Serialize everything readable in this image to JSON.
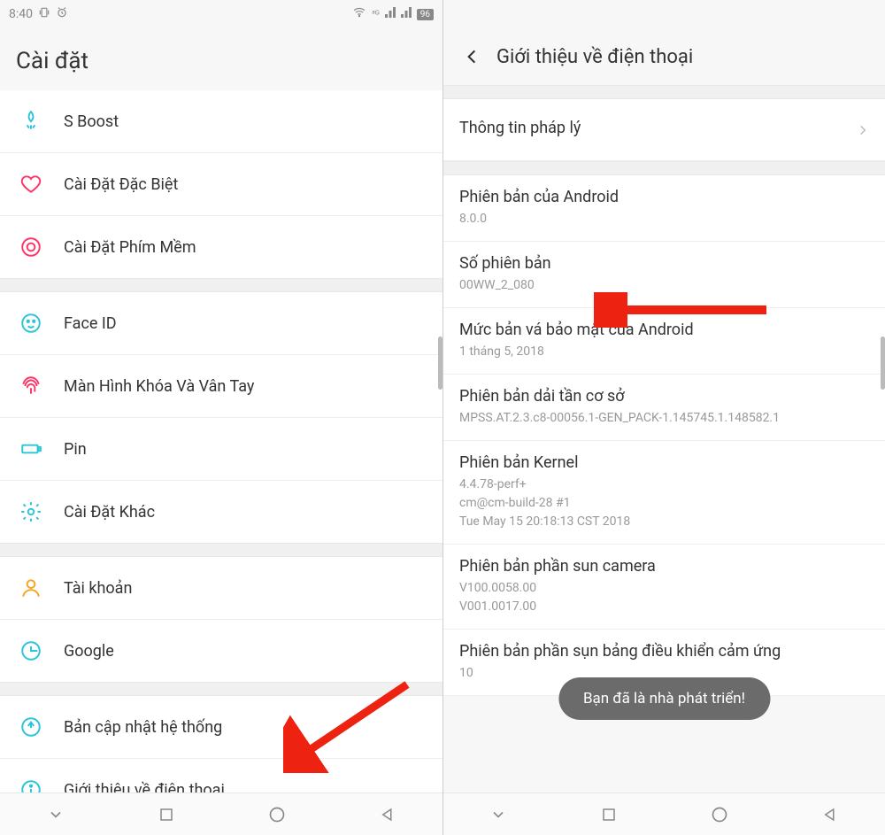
{
  "left": {
    "status": {
      "time": "8:40",
      "battery": "96"
    },
    "title": "Cài đặt",
    "groups": [
      [
        {
          "icon": "boost",
          "label": "S Boost",
          "color": "#29c5d8"
        },
        {
          "icon": "heart",
          "label": "Cài Đặt Đặc Biệt",
          "color": "#ff3366"
        },
        {
          "icon": "softkey",
          "label": "Cài Đặt Phím Mềm",
          "color": "#ff3366"
        }
      ],
      [
        {
          "icon": "face",
          "label": "Face ID",
          "color": "#29c5d8"
        },
        {
          "icon": "fingerprint",
          "label": "Màn Hình Khóa Và Vân Tay",
          "color": "#ff3366"
        },
        {
          "icon": "battery",
          "label": "Pin",
          "color": "#29c5d8"
        },
        {
          "icon": "gear",
          "label": "Cài Đặt Khác",
          "color": "#29c5d8"
        }
      ],
      [
        {
          "icon": "person",
          "label": "Tài khoản",
          "color": "#f5a623"
        },
        {
          "icon": "google",
          "label": "Google",
          "color": "#29c5d8"
        }
      ],
      [
        {
          "icon": "update",
          "label": "Bản cập nhật hệ thống",
          "color": "#29c5d8"
        },
        {
          "icon": "info",
          "label": "Giới thiệu về điện thoại",
          "color": "#29c5d8"
        }
      ]
    ]
  },
  "right": {
    "header": "Giới thiệu về điện thoại",
    "legal": "Thông tin pháp lý",
    "items": [
      {
        "title": "Phiên bản của Android",
        "sub": "8.0.0"
      },
      {
        "title": "Số phiên bản",
        "sub": "00WW_2_080"
      },
      {
        "title": "Mức bản vá bảo mật của Android",
        "sub": "1 tháng 5, 2018"
      },
      {
        "title": "Phiên bản dải tần cơ sở",
        "sub": "MPSS.AT.2.3.c8-00056.1-GEN_PACK-1.145745.1.148582.1"
      },
      {
        "title": "Phiên bản Kernel",
        "sub": "4.4.78-perf+\ncm@cm-build-28 #1\nTue May 15 20:18:13 CST 2018"
      },
      {
        "title": "Phiên bản phần sun camera",
        "sub": "V100.0058.00\nV001.0017.00"
      },
      {
        "title": "Phiên bản phần sụn bảng điều khiển cảm ứng",
        "sub": "10"
      }
    ],
    "toast": "Bạn đã là nhà phát triển!"
  }
}
